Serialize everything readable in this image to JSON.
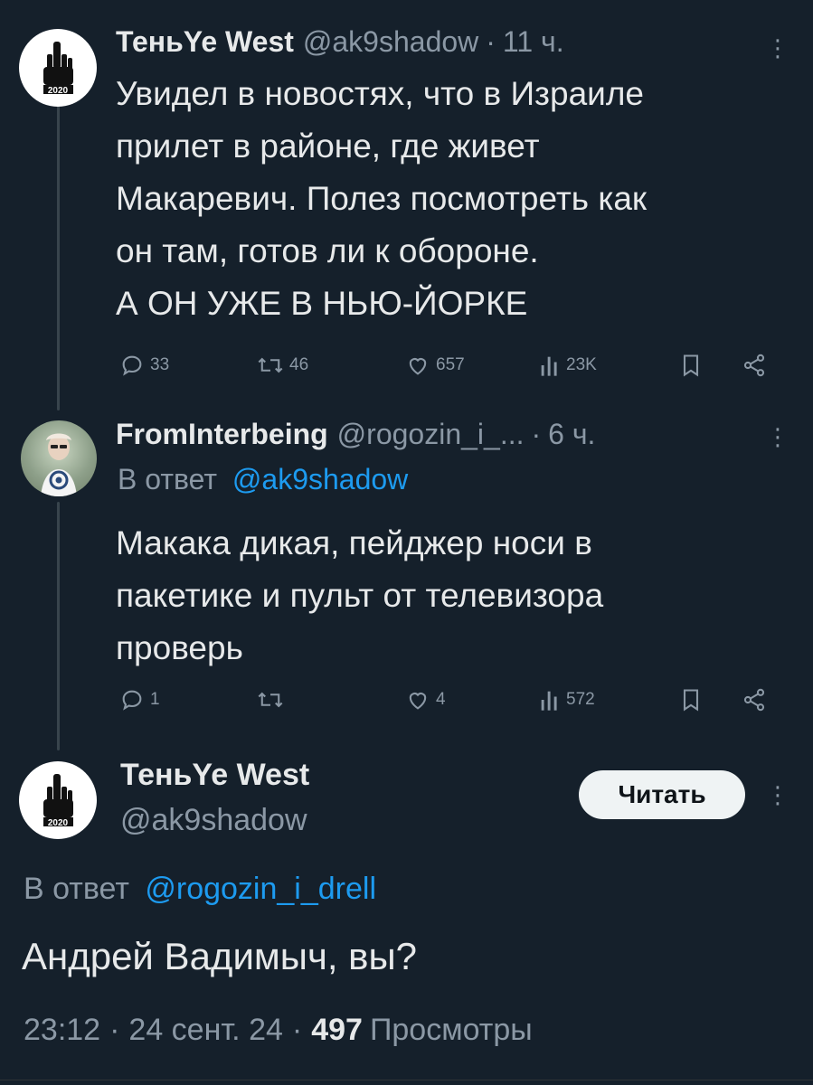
{
  "tweet1": {
    "display_name": "ТеньYe West",
    "handle": "@ak9shadow",
    "separator": "·",
    "time": "11 ч.",
    "more_icon": "⋮",
    "text_lines": [
      "Увидел в новостях, что в Израиле",
      "прилет в районе, где живет",
      "Макаревич. Полез посмотреть как",
      "он там, готов ли к обороне.",
      "А ОН УЖЕ В НЬЮ-ЙОРКЕ"
    ],
    "replies": "33",
    "retweets": "46",
    "likes": "657",
    "views": "23K"
  },
  "tweet2": {
    "display_name": "FromInterbeing",
    "handle": "@rogozin_i_...",
    "separator": "·",
    "time": "6 ч.",
    "more_icon": "⋮",
    "reply_prefix": "В ответ",
    "reply_to": "@ak9shadow",
    "text_lines": [
      "Макака дикая, пейджер носи в",
      "пакетике и пульт от телевизора",
      "проверь"
    ],
    "replies": "1",
    "retweets": "",
    "likes": "4",
    "views": "572"
  },
  "main_tweet": {
    "display_name": "ТеньYe West",
    "handle": "@ak9shadow",
    "follow_label": "Читать",
    "more_icon": "⋮",
    "reply_prefix": "В ответ",
    "reply_to": "@rogozin_i_drell",
    "text": "Андрей Вадимыч, вы?",
    "time": "23:12",
    "date": "24 сент. 24",
    "sep1": "·",
    "sep2": "·",
    "views_count": "497",
    "views_label": "Просмотры"
  },
  "colors": {
    "background": "#15202b",
    "text": "#e7e9ea",
    "muted": "#8b98a5",
    "link": "#1d9bf0"
  }
}
